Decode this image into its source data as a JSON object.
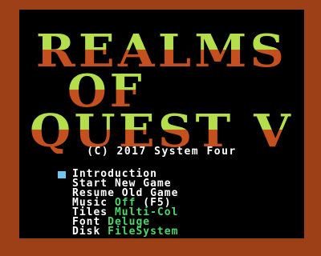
{
  "title": {
    "line1": "REALMS",
    "line2": "OF",
    "line3": "QUEST V"
  },
  "copyright": "(C) 2017 System Four",
  "menu": [
    {
      "label": "Introduction",
      "value": "",
      "extra": "",
      "selected": true
    },
    {
      "label": "Start New Game",
      "value": "",
      "extra": "",
      "selected": false
    },
    {
      "label": "Resume Old Game",
      "value": "",
      "extra": "",
      "selected": false
    },
    {
      "label": "Music",
      "value": "Off",
      "extra": "(F5)",
      "selected": false
    },
    {
      "label": "Tiles",
      "value": "Multi-Col",
      "extra": "",
      "selected": false
    },
    {
      "label": "Font",
      "value": "Deluge",
      "extra": "",
      "selected": false
    },
    {
      "label": "Disk",
      "value": "FileSystem",
      "extra": "",
      "selected": false
    }
  ],
  "colors": {
    "border": "#9d3f17",
    "background": "#000000",
    "title_top": "#b5de4c",
    "title_bottom": "#c4501f",
    "menu_text": "#ffffff",
    "menu_value": "#4cd66a",
    "cursor": "#6fc4f0"
  }
}
